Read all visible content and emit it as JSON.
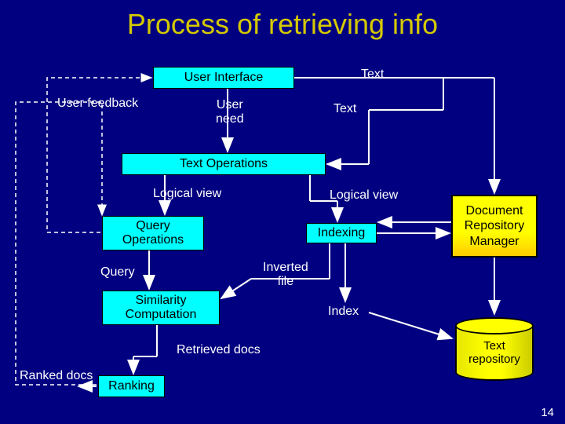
{
  "title": "Process of retrieving info",
  "boxes": {
    "user_interface": "User Interface",
    "text_operations": "Text Operations",
    "query_operations": "Query\nOperations",
    "similarity_computation": "Similarity\nComputation",
    "ranking": "Ranking",
    "indexing": "Indexing",
    "document_repository_manager": "Document\nRepository\nManager"
  },
  "labels": {
    "user_feedback": "User feedback",
    "user_need": "User\nneed",
    "text_top": "Text",
    "text_right": "Text",
    "logical_view_left": "Logical view",
    "logical_view_right": "Logical view",
    "query": "Query",
    "inverted_file": "Inverted\nfile",
    "index": "Index",
    "retrieved_docs": "Retrieved docs",
    "ranked_docs": "Ranked docs"
  },
  "cylinder": {
    "text_repository": "Text\nrepository"
  },
  "page_number": "14"
}
